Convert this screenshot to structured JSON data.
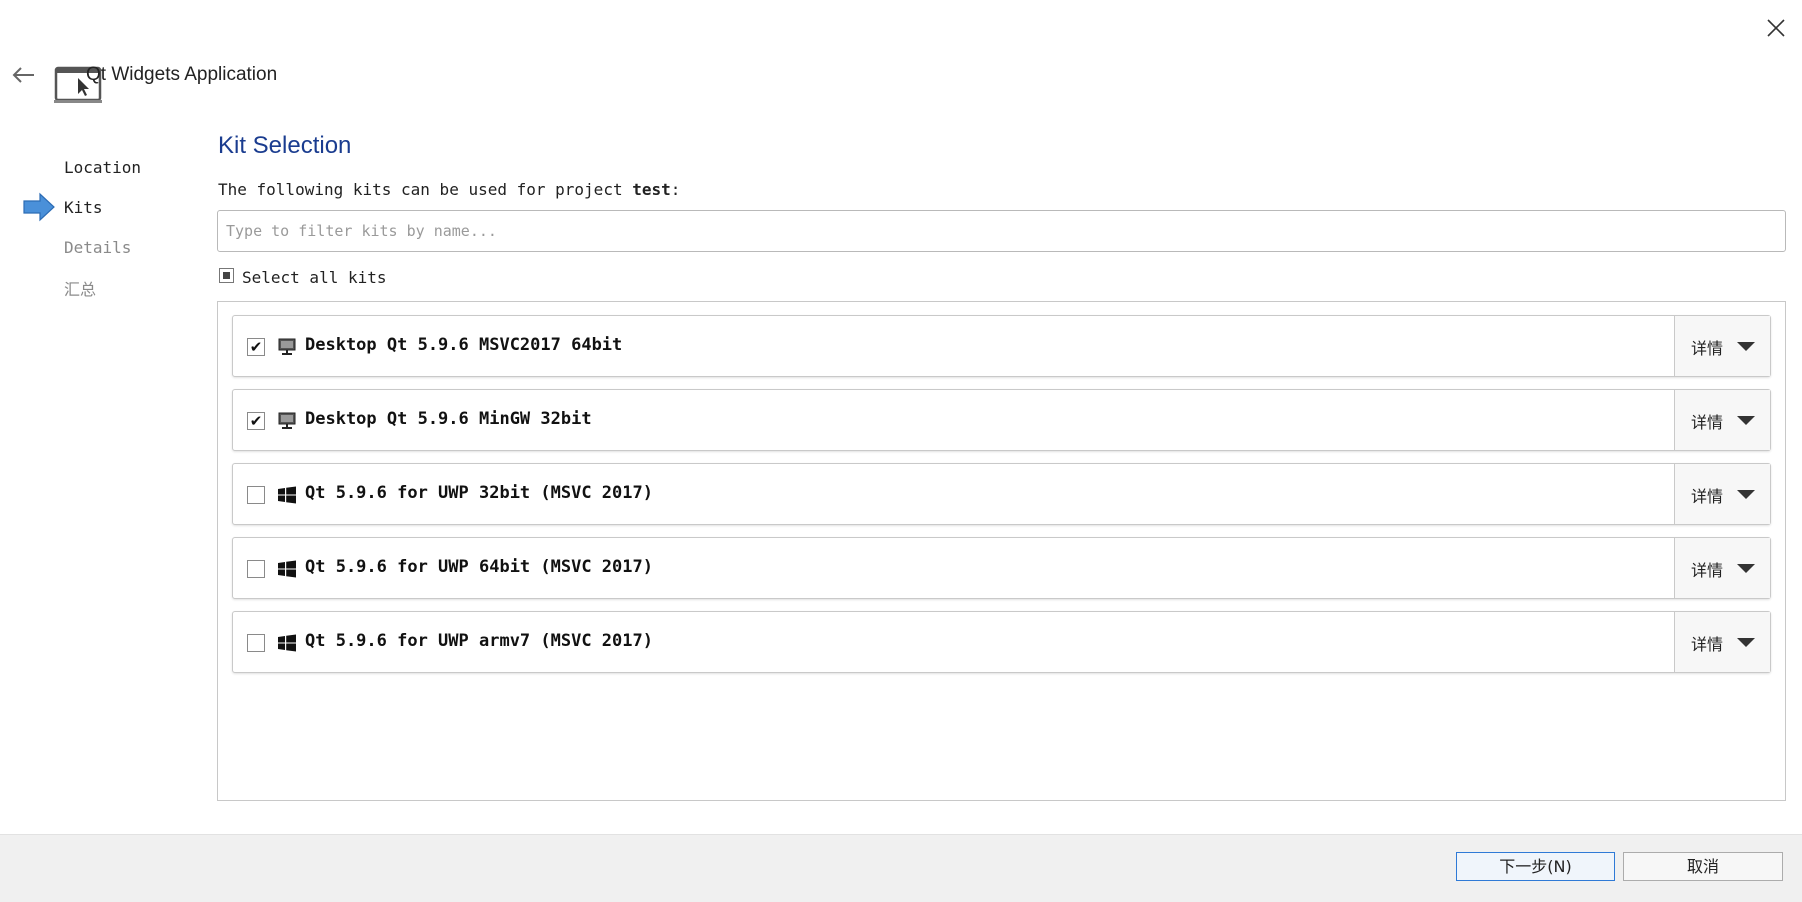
{
  "wizard": {
    "title": "Qt Widgets Application",
    "close_icon": "close-icon",
    "back_icon": "back-arrow-icon",
    "app_icon": "qt-widgets-app-icon"
  },
  "steps": [
    {
      "label": "Location",
      "state": "done"
    },
    {
      "label": "Kits",
      "state": "current"
    },
    {
      "label": "Details",
      "state": "pending"
    },
    {
      "label": "汇总",
      "state": "pending"
    }
  ],
  "main": {
    "title": "Kit Selection",
    "intro_prefix": "The following kits can be used for project ",
    "project_name": "test",
    "intro_suffix": ":",
    "filter_placeholder": "Type to filter kits by name...",
    "filter_value": "",
    "select_all_label": "Select all kits",
    "kits": [
      {
        "name": "Desktop Qt 5.9.6 MSVC2017 64bit",
        "checked": true,
        "icon": "desktop-monitor-icon",
        "details_label": "详情"
      },
      {
        "name": "Desktop Qt 5.9.6 MinGW 32bit",
        "checked": true,
        "icon": "desktop-monitor-icon",
        "details_label": "详情"
      },
      {
        "name": "Qt 5.9.6 for UWP 32bit (MSVC 2017)",
        "checked": false,
        "icon": "windows-logo-icon",
        "details_label": "详情"
      },
      {
        "name": "Qt 5.9.6 for UWP 64bit (MSVC 2017)",
        "checked": false,
        "icon": "windows-logo-icon",
        "details_label": "详情"
      },
      {
        "name": "Qt 5.9.6 for UWP armv7 (MSVC 2017)",
        "checked": false,
        "icon": "windows-logo-icon",
        "details_label": "详情"
      }
    ]
  },
  "footer": {
    "next_label": "下一步(N)",
    "cancel_label": "取消"
  },
  "colors": {
    "title_blue": "#1a3c8f",
    "step_arrow": "#4a90d9",
    "focus_border": "#2f7ad6"
  }
}
